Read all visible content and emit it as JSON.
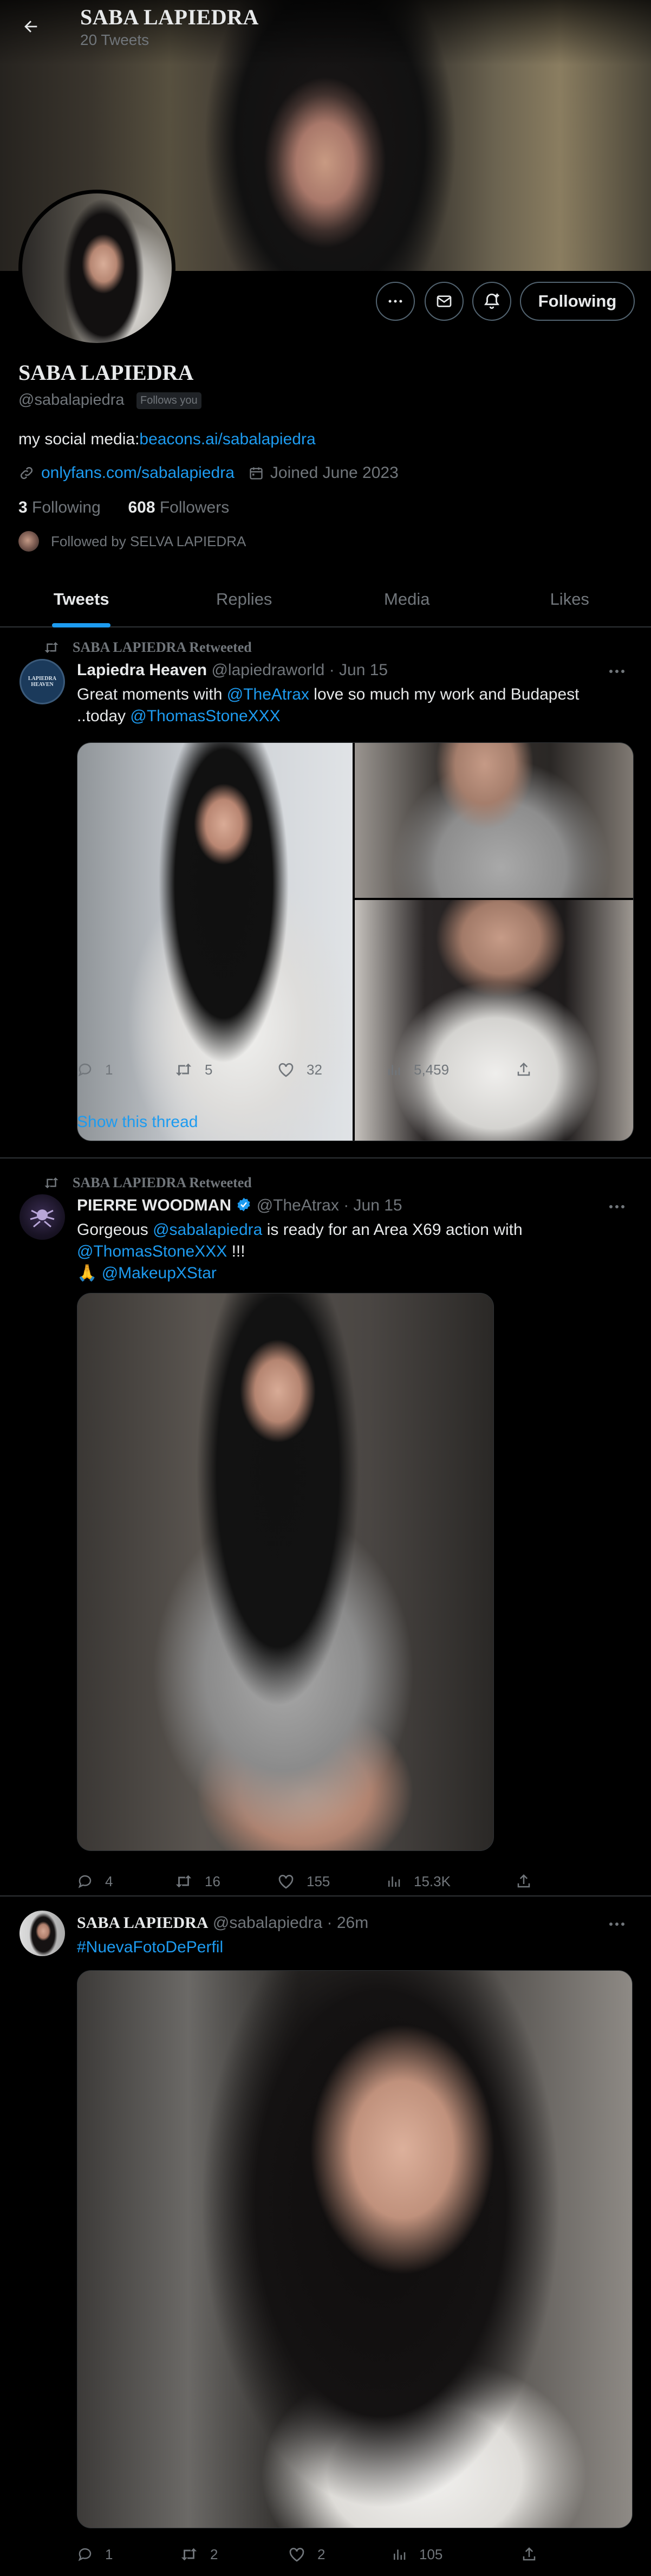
{
  "colors": {
    "accent": "#1d9bf0",
    "text": "#e7e9ea",
    "muted": "#71767b",
    "border": "#2f3336",
    "background": "#000000"
  },
  "header": {
    "title": "SABA LAPIEDRA",
    "tweet_count": "20 Tweets",
    "back_icon": "arrow-left-icon"
  },
  "profile": {
    "display_name": "SABA LAPIEDRA",
    "handle": "@sabalapiedra",
    "follows_you": "Follows you",
    "bio_prefix": "my social media:",
    "bio_link": "beacons.ai/sabalapiedra",
    "website": "onlyfans.com/sabalapiedra",
    "joined": "Joined June 2023",
    "following_count": "3",
    "following_label": "Following",
    "followers_count": "608",
    "followers_label": "Followers",
    "followed_by": "Followed by SELVA LAPIEDRA",
    "following_button": "Following"
  },
  "tabs": [
    {
      "label": "Tweets",
      "active": true
    },
    {
      "label": "Replies",
      "active": false
    },
    {
      "label": "Media",
      "active": false
    },
    {
      "label": "Likes",
      "active": false
    }
  ],
  "tweets": [
    {
      "retweet_label": "SABA LAPIEDRA Retweeted",
      "avatar_text": "LAPIEDRA\nHEAVEN",
      "name": "Lapiedra Heaven",
      "handle": "@lapiedraworld",
      "sep": "·",
      "time": "Jun 15",
      "text_1": "Great moments with ",
      "mention_1": "@TheAtrax",
      "text_2": " love so much my work and Budapest",
      "text_3": "..today ",
      "mention_2": "@ThomasStoneXXX",
      "replies": "1",
      "retweets": "5",
      "likes": "32",
      "views": "5,459",
      "show_thread": "Show this thread"
    },
    {
      "retweet_label": "SABA LAPIEDRA Retweeted",
      "name": "PIERRE WOODMAN",
      "handle": "@TheAtrax",
      "sep": "·",
      "time": "Jun 15",
      "text_1": "Gorgeous ",
      "mention_1": "@sabalapiedra",
      "text_2": " is ready for an Area X69 action with",
      "mention_2": "@ThomasStoneXXX",
      "text_3": " !!!",
      "emoji": "🙏",
      "mention_3": "@MakeupXStar",
      "replies": "4",
      "retweets": "16",
      "likes": "155",
      "views": "15.3K"
    },
    {
      "name": "SABA LAPIEDRA",
      "handle": "@sabalapiedra",
      "sep": "·",
      "time": "26m",
      "hashtag": "#NuevaFotoDePerfil",
      "replies": "1",
      "retweets": "2",
      "likes": "2",
      "views": "105"
    }
  ]
}
